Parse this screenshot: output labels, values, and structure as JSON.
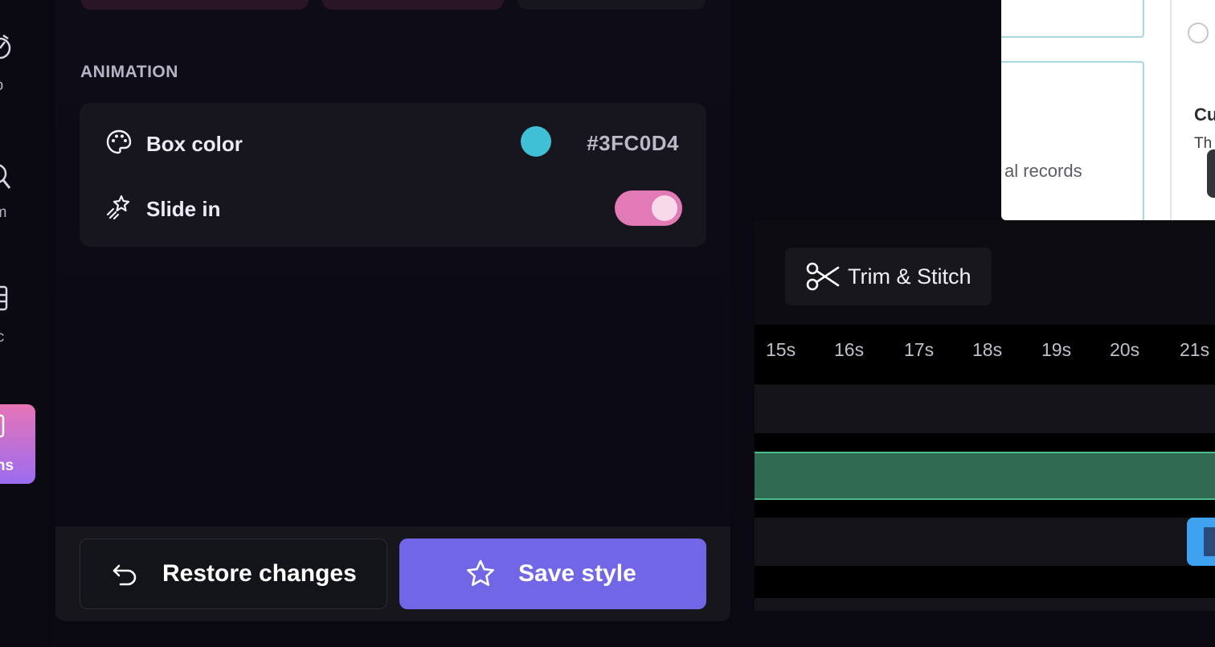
{
  "sidebar": {
    "items": [
      {
        "label": "tro",
        "icon": "timer-icon"
      },
      {
        "label": "om",
        "icon": "zoom-icon"
      },
      {
        "label": "sic",
        "icon": "music-icon"
      },
      {
        "label": "ions",
        "icon": "captions-icon",
        "active": true
      }
    ]
  },
  "panel": {
    "section_title": "ANIMATION",
    "rows": [
      {
        "label": "Box color",
        "icon": "palette-icon",
        "swatch_color": "#3FC0D4",
        "value": "#3FC0D4"
      },
      {
        "label": "Slide in",
        "icon": "sparkle-icon",
        "toggle": true
      }
    ],
    "restore_label": "Restore changes",
    "save_label": "Save style"
  },
  "preview": {
    "text_1": "al records",
    "text_2": "Cu",
    "text_3": "Th"
  },
  "timeline": {
    "trim_label": "Trim & Stitch",
    "ticks": [
      "15s",
      "16s",
      "17s",
      "18s",
      "19s",
      "20s",
      "21s"
    ]
  },
  "colors": {
    "accent": "#7066E6",
    "toggle_on": "#E27AB6",
    "track_green": "#2E6B52",
    "clip_blue": "#3EA2F0"
  }
}
